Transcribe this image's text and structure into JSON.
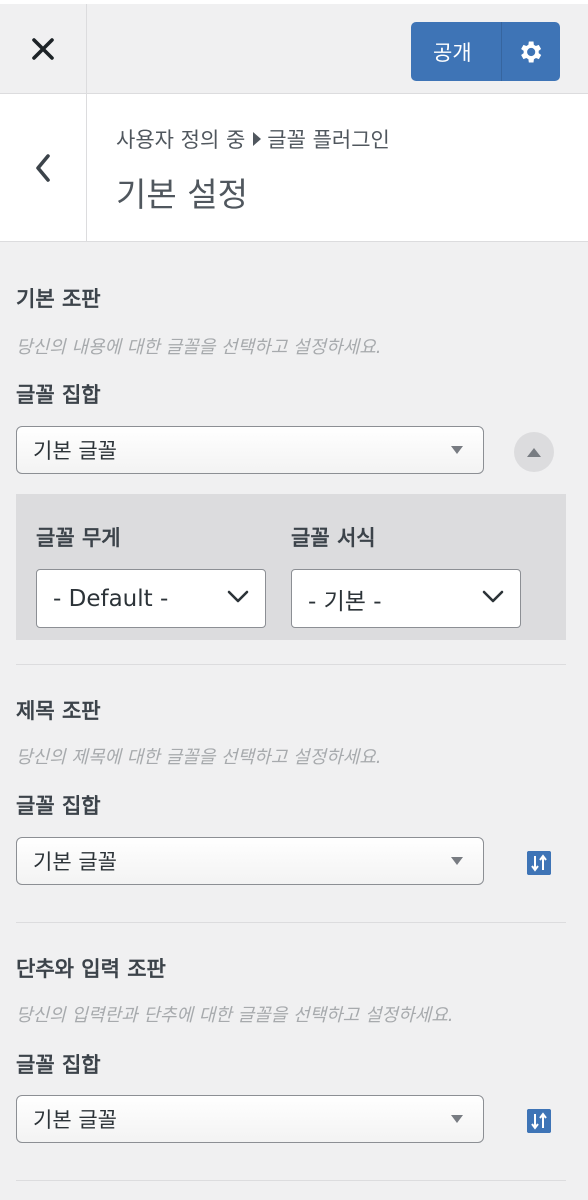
{
  "topbar": {
    "close_icon": "close-icon",
    "publish_label": "공개",
    "settings_icon": "gear-icon"
  },
  "header": {
    "breadcrumb_parent": "사용자 정의 중",
    "breadcrumb_child": "글꼴 플러그인",
    "title": "기본 설정"
  },
  "base": {
    "title": "기본 조판",
    "description": "당신의 내용에 대한 글꼴을 선택하고 설정하세요.",
    "family_label": "글꼴 집합",
    "family_value": "기본 글꼴",
    "weight_label": "글꼴 무게",
    "weight_value": "- Default -",
    "style_label": "글꼴 서식",
    "style_value": "- 기본 -"
  },
  "headings": {
    "title": "제목 조판",
    "description": "당신의 제목에 대한 글꼴을 선택하고 설정하세요.",
    "family_label": "글꼴 집합",
    "family_value": "기본 글꼴"
  },
  "buttons": {
    "title": "단추와 입력 조판",
    "description": "당신의 입력란과 단추에 대한 글꼴을 선택하고 설정하세요.",
    "family_label": "글꼴 집합",
    "family_value": "기본 글꼴"
  },
  "colors": {
    "accent": "#3e74b6",
    "background": "#f0f0f1"
  }
}
